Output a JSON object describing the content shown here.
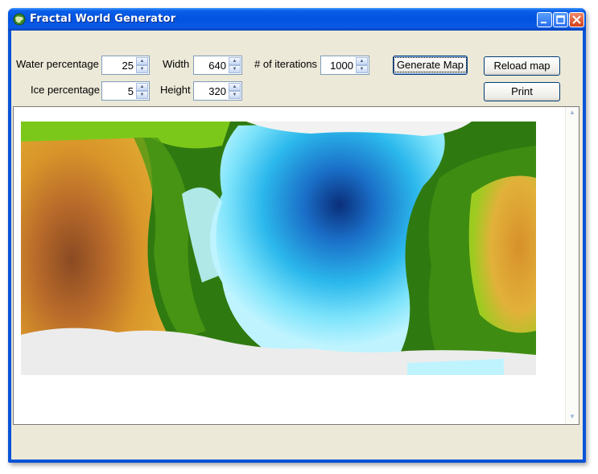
{
  "window": {
    "title": "Fractal World Generator"
  },
  "controls": {
    "water": {
      "label": "Water percentage",
      "value": "25"
    },
    "ice": {
      "label": "Ice percentage",
      "value": "5"
    },
    "width": {
      "label": "Width",
      "value": "640"
    },
    "height": {
      "label": "Height",
      "value": "320"
    },
    "iterations": {
      "label": "# of iterations",
      "value": "1000"
    }
  },
  "buttons": {
    "generate": "Generate Map",
    "reload": "Reload map",
    "print": "Print"
  },
  "icons": {
    "app": "globe-icon",
    "minimize": "minimize-icon",
    "maximize": "maximize-icon",
    "close": "close-icon"
  },
  "colors": {
    "deep_water": "#0a2e7a",
    "shallow_water": "#bff4ff",
    "forest": "#2f7a10",
    "grass": "#7cc81a",
    "desert": "#d9952a",
    "mountain": "#8a4a22",
    "ice": "#eeeeee"
  }
}
